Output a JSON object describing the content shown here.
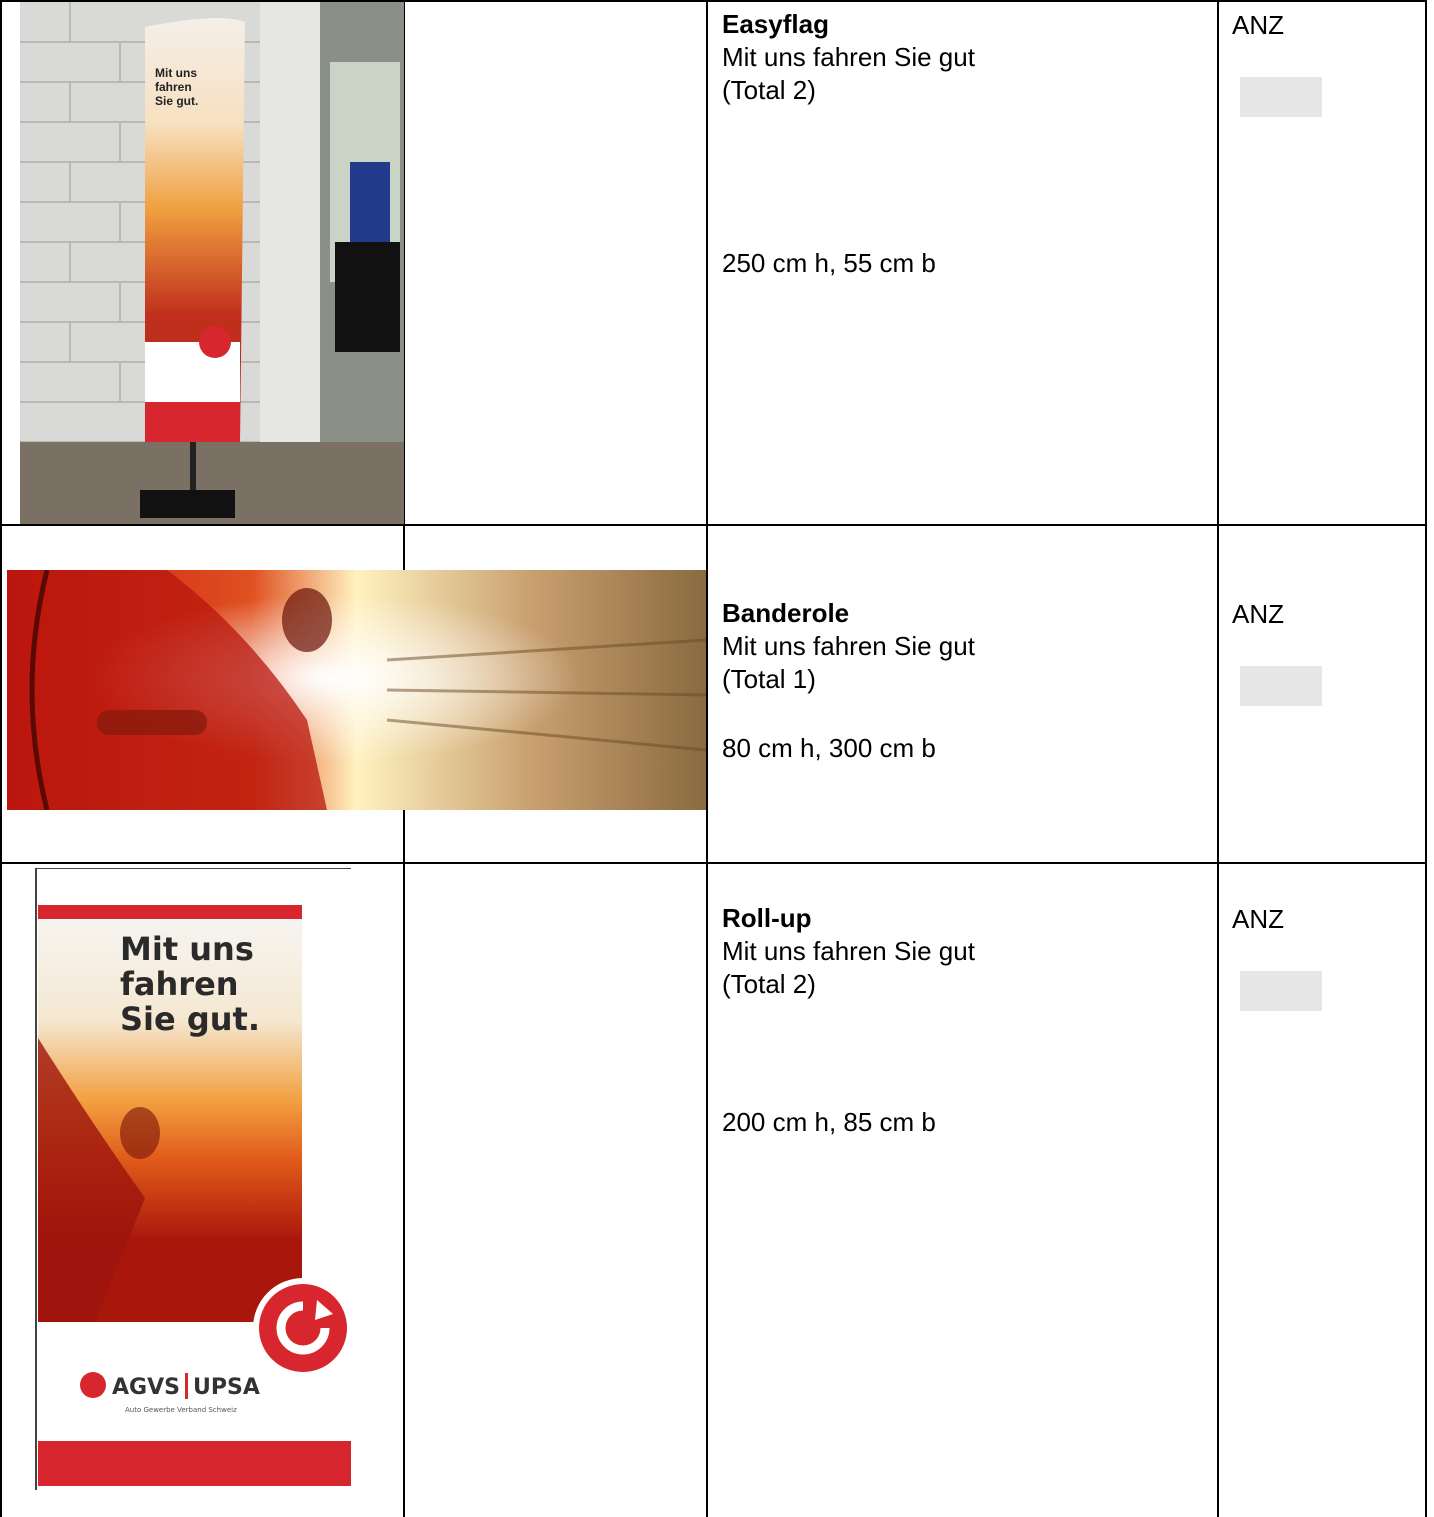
{
  "rows": [
    {
      "title": "Easyflag",
      "subtitle": "Mit uns fahren Sie gut",
      "total": "(Total 2)",
      "dims": "250 cm h, 55 cm b",
      "anz_label": "ANZ",
      "anz_value": ""
    },
    {
      "title": "Banderole",
      "subtitle": "Mit uns fahren Sie gut",
      "total": "(Total 1)",
      "dims": "80 cm h, 300 cm b",
      "anz_label": "ANZ",
      "anz_value": ""
    },
    {
      "title": "Roll-up",
      "subtitle": "Mit uns fahren Sie gut",
      "total": "(Total 2)",
      "dims": "200 cm h, 85 cm b",
      "anz_label": "ANZ",
      "anz_value": ""
    }
  ],
  "images": {
    "easyflag": {
      "slogan": "Mit uns fahren Sie gut."
    },
    "rollup": {
      "slogan_line1": "Mit uns",
      "slogan_line2": "fahren",
      "slogan_line3": "Sie gut.",
      "logo_left": "AGVS",
      "logo_right": "UPSA",
      "logo_sub": "Auto Gewerbe Verband Schweiz"
    }
  },
  "colors": {
    "brand_red": "#d8262e",
    "field_grey": "#e6e6e6"
  }
}
